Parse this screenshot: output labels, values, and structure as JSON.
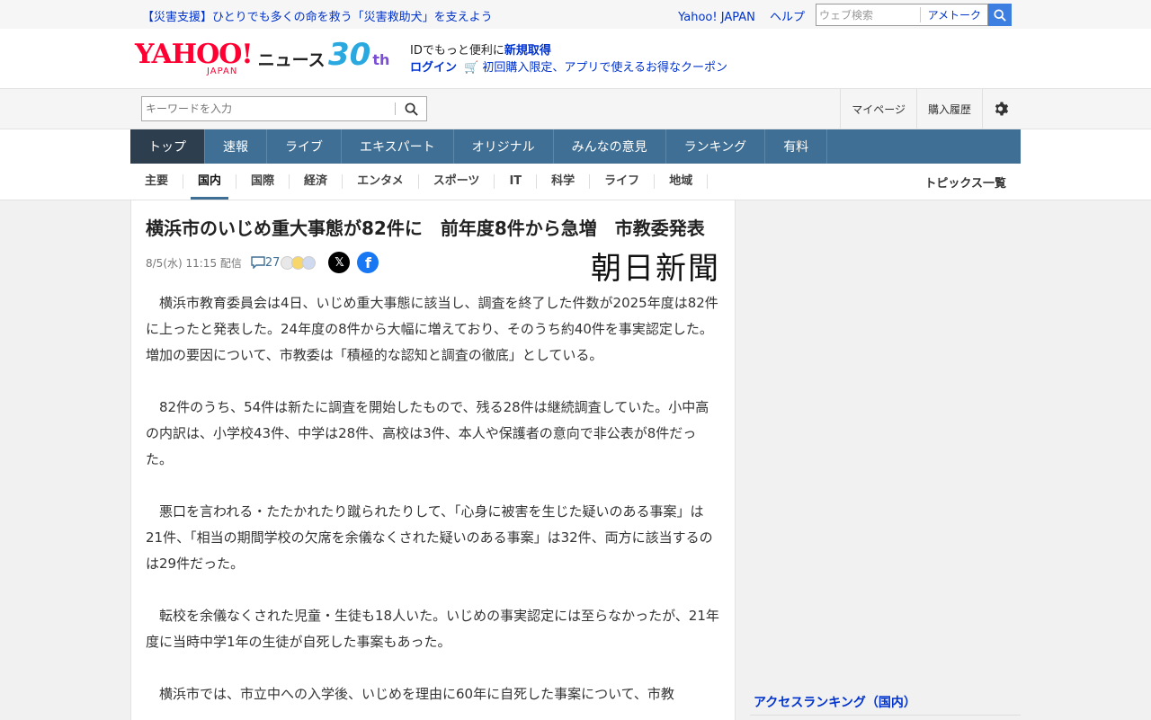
{
  "top_bar": {
    "promo": "【災害支援】ひとりでも多くの命を救う「災害救助犬」を支えよう",
    "links": [
      "Yahoo! JAPAN",
      "ヘルプ"
    ],
    "web_search_placeholder": "ウェブ検索",
    "ametoku": "アメトーク"
  },
  "header": {
    "logo_yahoo": "YAHOO!",
    "logo_japan": "JAPAN",
    "logo_news": "ニュース",
    "anniv_num": "30",
    "anniv_suffix": "th",
    "id_line_prefix": "IDでもっと便利に",
    "id_line_link": "新規取得",
    "login": "ログイン",
    "coupon": "初回購入限定、アプリで使えるお得なクーポン"
  },
  "search": {
    "placeholder": "キーワードを入力",
    "util_links": [
      "マイページ",
      "購入履歴"
    ]
  },
  "nav": {
    "tabs": [
      "トップ",
      "速報",
      "ライブ",
      "エキスパート",
      "オリジナル",
      "みんなの意見",
      "ランキング",
      "有料"
    ]
  },
  "subnav": {
    "categories": [
      "主要",
      "国内",
      "国際",
      "経済",
      "エンタメ",
      "スポーツ",
      "IT",
      "科学",
      "ライフ",
      "地域"
    ],
    "topics": "トピックス一覧"
  },
  "article": {
    "title": "横浜市のいじめ重大事態が82件に　前年度8件から急増　市教委発表",
    "date": "8/5(水) 11:15 配信",
    "comment_count": "27",
    "publisher": "朝日新聞",
    "paragraphs": [
      "　横浜市教育委員会は4日、いじめ重大事態に該当し、調査を終了した件数が2025年度は82件に上ったと発表した。24年度の8件から大幅に増えており、そのうち約40件を事実認定した。増加の要因について、市教委は「積極的な認知と調査の徹底」としている。",
      "　82件のうち、54件は新たに調査を開始したもので、残る28件は継続調査していた。小中高の内訳は、小学校43件、中学は28件、高校は3件、本人や保護者の意向で非公表が8件だった。",
      "　悪口を言われる・たたかれたり蹴られたりして、「心身に被害を生じた疑いのある事案」は21件、「相当の期間学校の欠席を余儀なくされた疑いのある事案」は32件、両方に該当するのは29件だった。",
      "　転校を余儀なくされた児童・生徒も18人いた。いじめの事実認定には至らなかったが、21年度に当時中学1年の生徒が自死した事案もあった。",
      "　横浜市では、市立中への入学後、いじめを理由に60年に自死した事案について、市教"
    ]
  },
  "sidebar": {
    "ranking_title": "アクセスランキング（国内）"
  }
}
